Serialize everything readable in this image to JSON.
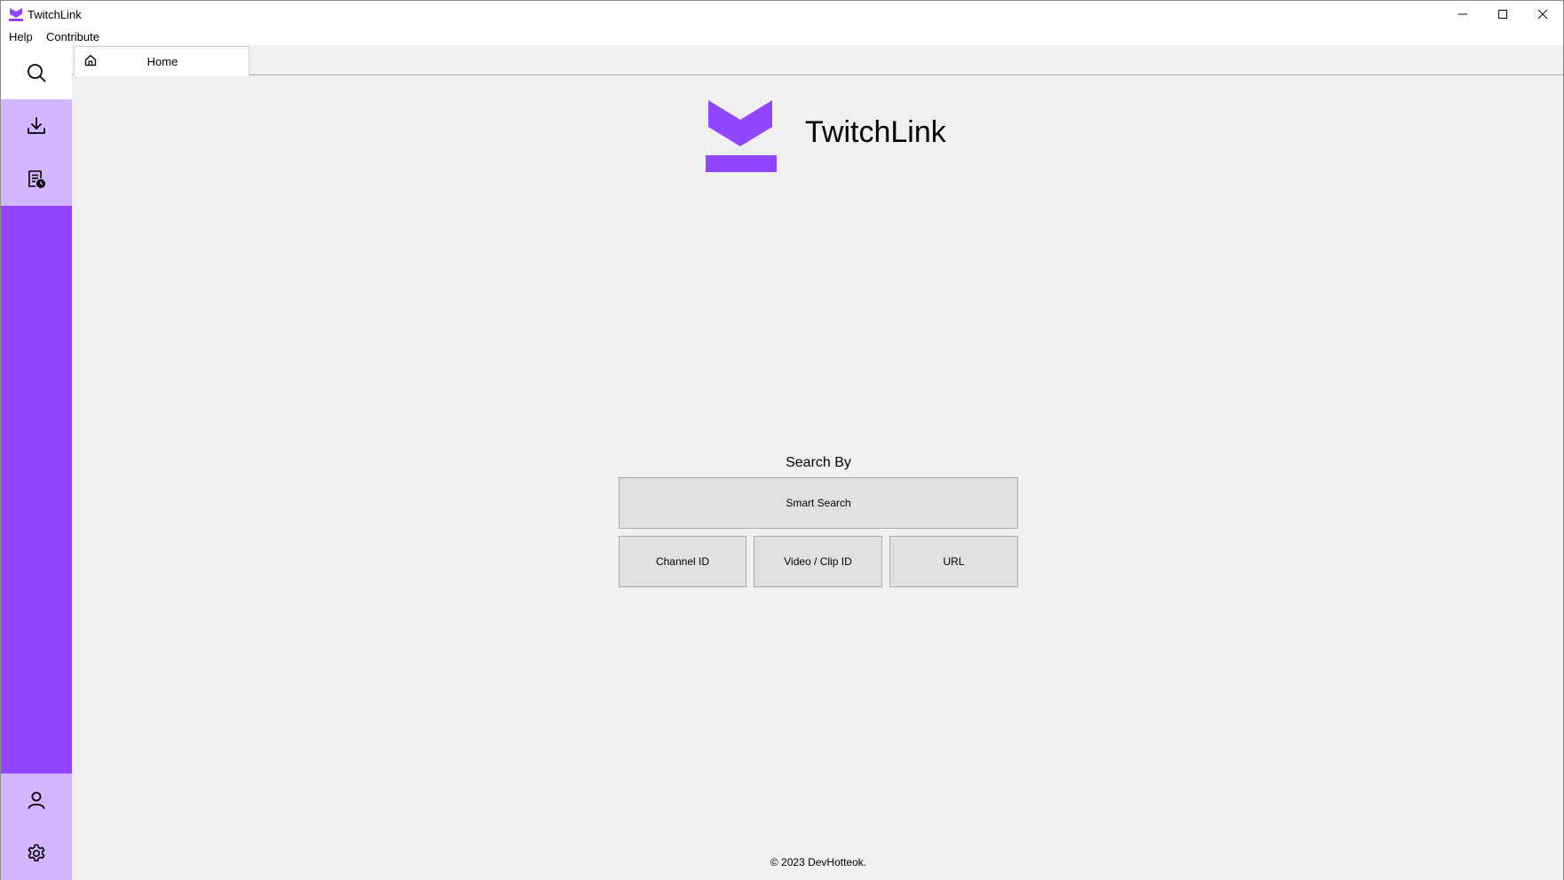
{
  "window": {
    "title": "TwitchLink",
    "controls": {
      "minimize": "minimize-icon",
      "maximize": "maximize-icon",
      "close": "close-icon"
    }
  },
  "menu": {
    "help": "Help",
    "contribute": "Contribute"
  },
  "sidebar": {
    "items": [
      {
        "icon": "search-icon",
        "selected": true
      },
      {
        "icon": "download-icon",
        "selected": false
      },
      {
        "icon": "history-icon",
        "selected": false
      },
      {
        "icon": "account-icon",
        "selected": false
      },
      {
        "icon": "settings-icon",
        "selected": false
      }
    ]
  },
  "tabs": [
    {
      "label": "Home",
      "icon": "home-icon"
    }
  ],
  "main": {
    "app_name": "TwitchLink",
    "search_by_label": "Search By",
    "buttons": {
      "smart_search": "Smart Search",
      "channel_id": "Channel ID",
      "video_clip_id": "Video / Clip ID",
      "url": "URL"
    },
    "footer": "© 2023 DevHotteok."
  },
  "colors": {
    "brand": "#9146ff",
    "sidebar_button": "#d2b6ff",
    "content_bg": "#f0f0f0",
    "button_bg": "#e1e1e1"
  }
}
